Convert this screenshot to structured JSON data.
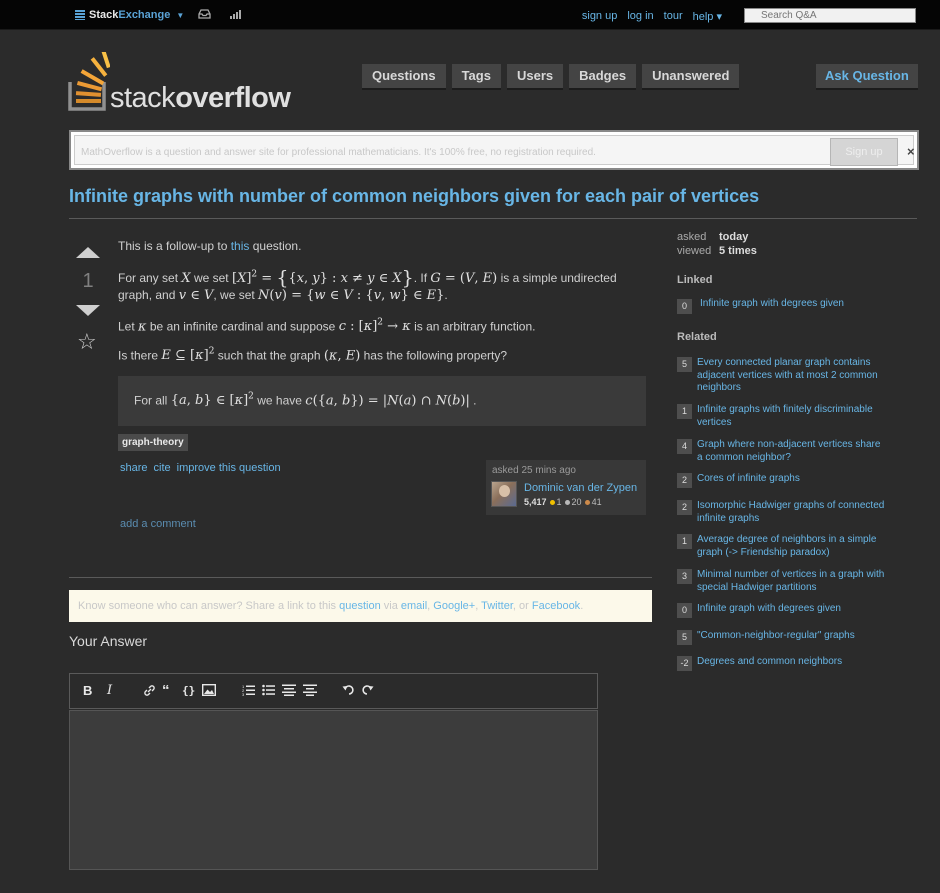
{
  "topbar": {
    "brand_a": "Stack",
    "brand_b": "Exchange",
    "links": [
      "sign up",
      "log in",
      "tour",
      "help ▾"
    ],
    "search_placeholder": "Search Q&A"
  },
  "logo": {
    "text_a": "stack",
    "text_b": "overflow"
  },
  "nav": {
    "items": [
      "Questions",
      "Tags",
      "Users",
      "Badges",
      "Unanswered"
    ],
    "ask": "Ask Question"
  },
  "notice": {
    "text": "MathOverflow is a question and answer site for professional mathematicians. It's 100% free, no registration required.",
    "signup": "Sign up",
    "close": "×"
  },
  "question": {
    "title": "Infinite graphs with number of common neighbors given for each pair of vertices",
    "votes": "1",
    "p1_pre": "This is a follow-up to ",
    "p1_link": "this",
    "p1_post": " question.",
    "p2a": "For any set ",
    "p2b": " we set ",
    "p2c": ". If ",
    "p2d": " is a simple undirected",
    "p3a": "graph, and ",
    "p3b": ", we set ",
    "p4a": "Let ",
    "p4b": " be an infinite cardinal and suppose ",
    "p4c": " is an arbitrary function.",
    "p5a": "Is there ",
    "p5b": " such that the graph ",
    "p5c": " has the following property?",
    "quote_a": "For all ",
    "quote_b": " we have ",
    "tag": "graph-theory",
    "menu": [
      "share",
      "cite",
      "improve this question"
    ],
    "asked": "asked 25 mins ago",
    "user_name": "Dominic van der Zypen",
    "user_rep": "5,417",
    "gold": "1",
    "silver": "20",
    "bronze": "41",
    "add_comment": "add a comment"
  },
  "share": {
    "pre": "Know someone who can answer? Share a link to this ",
    "question": "question",
    "via": " via ",
    "email": "email",
    "google": "Google+",
    "twitter": "Twitter",
    "or": ", or ",
    "facebook": "Facebook",
    "end": "."
  },
  "answer": {
    "heading": "Your Answer"
  },
  "sidebar": {
    "asked_label": "asked",
    "asked_value": "today",
    "viewed_label": "viewed",
    "viewed_value": "5 times",
    "linked_heading": "Linked",
    "linked": [
      {
        "score": "0",
        "title": "Infinite graph with degrees given"
      }
    ],
    "related_heading": "Related",
    "related": [
      {
        "score": "5",
        "title": "Every connected planar graph contains adjacent vertices with at most 2 common neighbors"
      },
      {
        "score": "1",
        "title": "Infinite graphs with finitely discriminable vertices"
      },
      {
        "score": "4",
        "title": "Graph where non-adjacent vertices share a common neighbor?"
      },
      {
        "score": "2",
        "title": "Cores of infinite graphs"
      },
      {
        "score": "2",
        "title": "Isomorphic Hadwiger graphs of connected infinite graphs"
      },
      {
        "score": "1",
        "title": "Average degree of neighbors in a simple graph (-> Friendship paradox)"
      },
      {
        "score": "3",
        "title": "Minimal number of vertices in a graph with special Hadwiger partitions"
      },
      {
        "score": "0",
        "title": "Infinite graph with degrees given"
      },
      {
        "score": "5",
        "title": "\"Common-neighbor-regular\" graphs"
      },
      {
        "score": "-2",
        "title": "Degrees and common neighbors"
      }
    ]
  }
}
